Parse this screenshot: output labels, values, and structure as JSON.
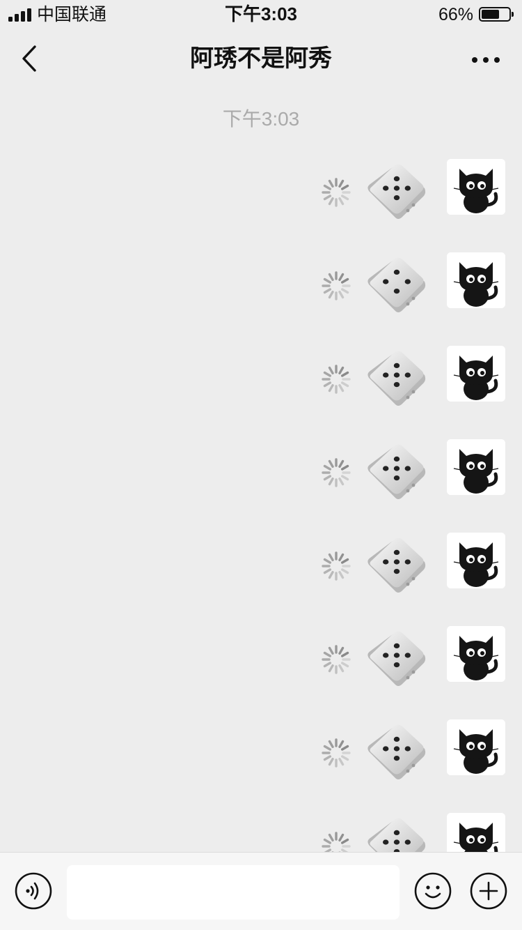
{
  "status_bar": {
    "carrier": "中国联通",
    "time": "下午3:03",
    "battery_percent": "66%",
    "battery_level": 0.66,
    "signal_bars": 4
  },
  "nav": {
    "title": "阿琇不是阿秀",
    "back_icon": "chevron-left-icon",
    "more_icon": "ellipsis-icon"
  },
  "chat": {
    "timestamp": "下午3:03",
    "messages": [
      {
        "type": "dice",
        "pips": 5,
        "status": "sending"
      },
      {
        "type": "dice",
        "pips": 4,
        "status": "sending"
      },
      {
        "type": "dice",
        "pips": 5,
        "status": "sending"
      },
      {
        "type": "dice",
        "pips": 5,
        "status": "sending"
      },
      {
        "type": "dice",
        "pips": 5,
        "status": "sending"
      },
      {
        "type": "dice",
        "pips": 5,
        "status": "sending"
      },
      {
        "type": "dice",
        "pips": 5,
        "status": "sending"
      },
      {
        "type": "dice",
        "pips": 5,
        "status": "sending"
      }
    ],
    "avatar_icon": "black-cat-avatar"
  },
  "input_bar": {
    "voice_icon": "voice-icon",
    "input_value": "",
    "emoji_icon": "emoji-icon",
    "plus_icon": "plus-circle-icon"
  },
  "colors": {
    "background": "#ededed",
    "timestamp": "#aaaaaa",
    "input_bar": "#f6f6f6"
  }
}
